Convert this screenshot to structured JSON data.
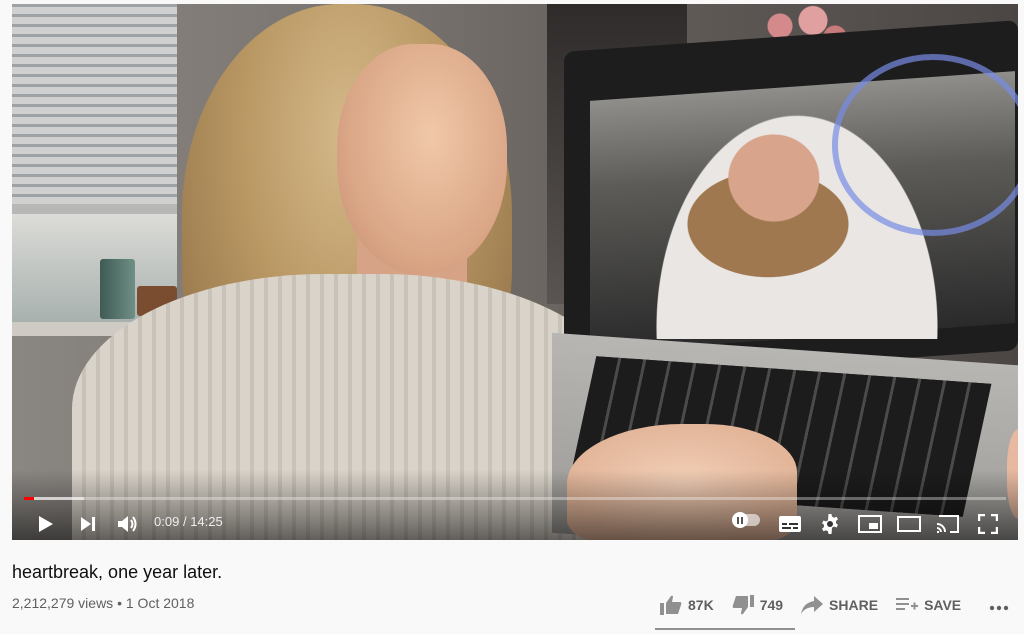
{
  "video": {
    "title": "heartbreak, one year later.",
    "views": "2,212,279 views",
    "separator": "•",
    "date": "1 Oct 2018",
    "progress_fraction": 0.0106
  },
  "player": {
    "current_time": "0:09",
    "time_separator": "/",
    "duration": "14:25",
    "buttons": [
      {
        "name": "play-icon"
      },
      {
        "name": "next-icon"
      },
      {
        "name": "volume-icon"
      },
      {
        "name": "autoplay-toggle"
      },
      {
        "name": "subtitles-icon"
      },
      {
        "name": "settings-gear-icon"
      },
      {
        "name": "miniplayer-icon"
      },
      {
        "name": "theater-mode-icon"
      },
      {
        "name": "cast-icon"
      },
      {
        "name": "fullscreen-icon"
      }
    ]
  },
  "actions": {
    "like_count": "87K",
    "dislike_count": "749",
    "share_label": "SHARE",
    "save_label": "SAVE",
    "more_icon": "more-horizontal-icon"
  },
  "colors": {
    "progress_played": "#ff0000",
    "text_primary": "#0f0f0f",
    "text_secondary": "#606060"
  }
}
